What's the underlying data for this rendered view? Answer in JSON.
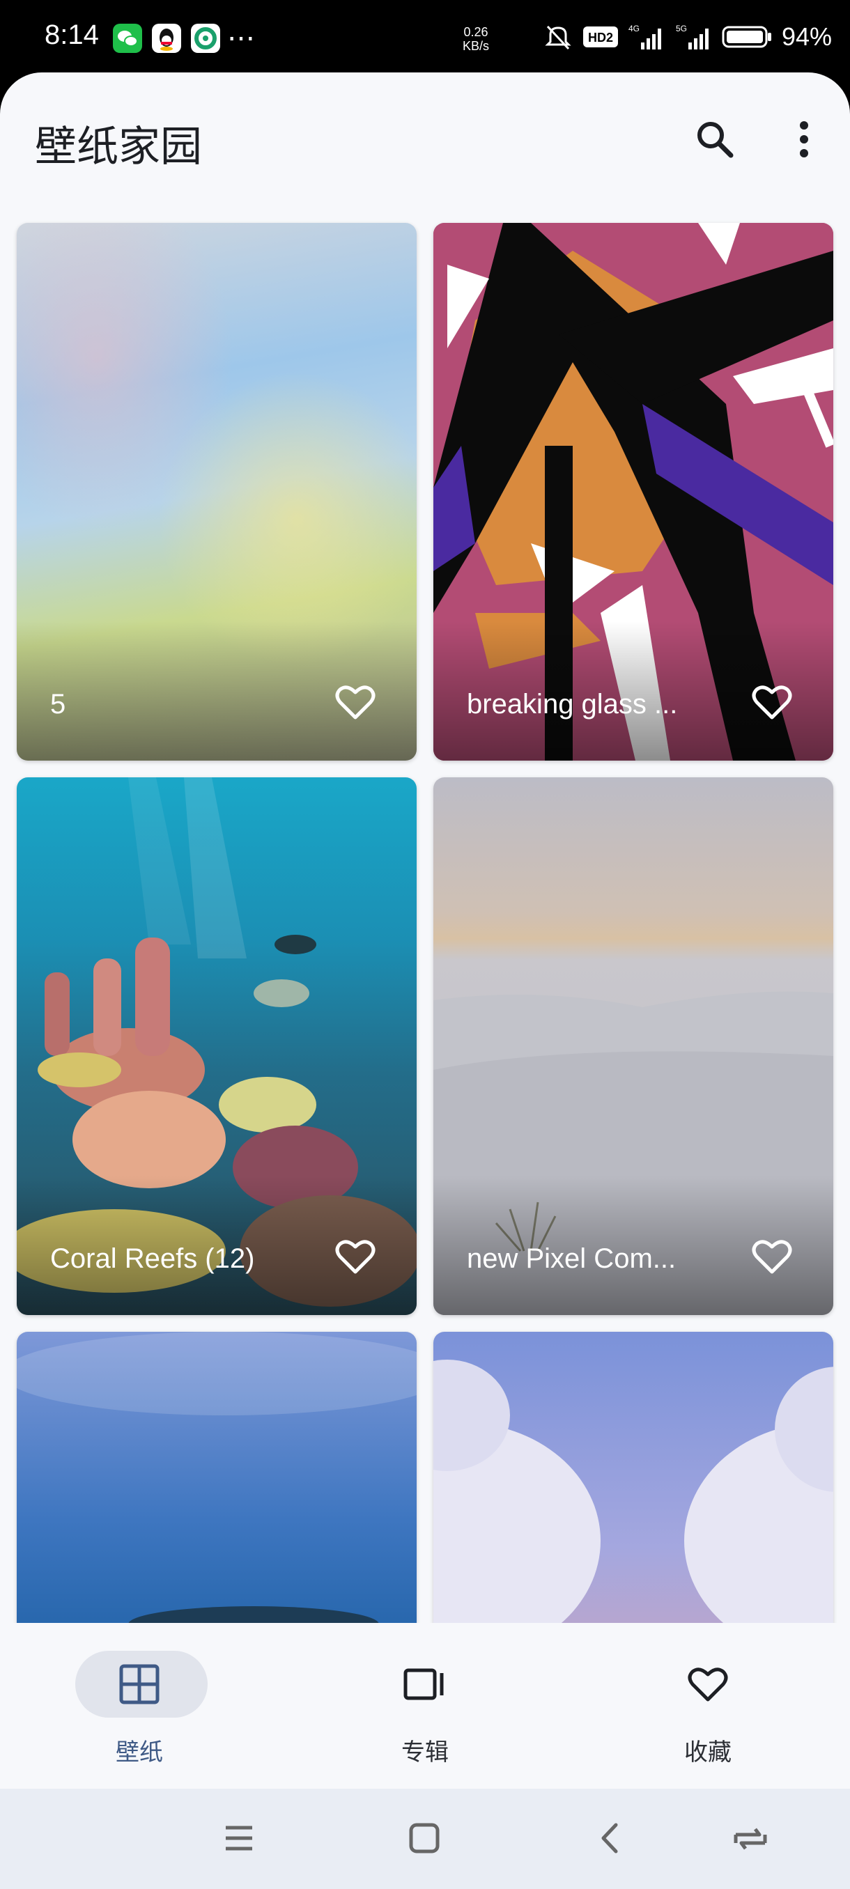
{
  "status": {
    "time": "8:14",
    "speed_top": "0.26",
    "speed_bottom": "KB/s",
    "battery": "94%",
    "more": "…"
  },
  "header": {
    "title": "壁纸家园",
    "search_icon": "search-icon",
    "more_icon": "more-vert-icon"
  },
  "wallpapers": [
    {
      "label": "5"
    },
    {
      "label": "breaking glass ..."
    },
    {
      "label": "Coral Reefs (12)"
    },
    {
      "label": "new Pixel Com..."
    },
    {
      "label": ""
    },
    {
      "label": ""
    }
  ],
  "nav": [
    {
      "label": "壁纸",
      "icon": "grid-icon",
      "active": true
    },
    {
      "label": "专辑",
      "icon": "album-icon",
      "active": false
    },
    {
      "label": "收藏",
      "icon": "heart-icon",
      "active": false
    }
  ],
  "colors": {
    "accent": "#3f5a86",
    "surface": "#f7f8fb",
    "pill": "#e1e4ec"
  }
}
